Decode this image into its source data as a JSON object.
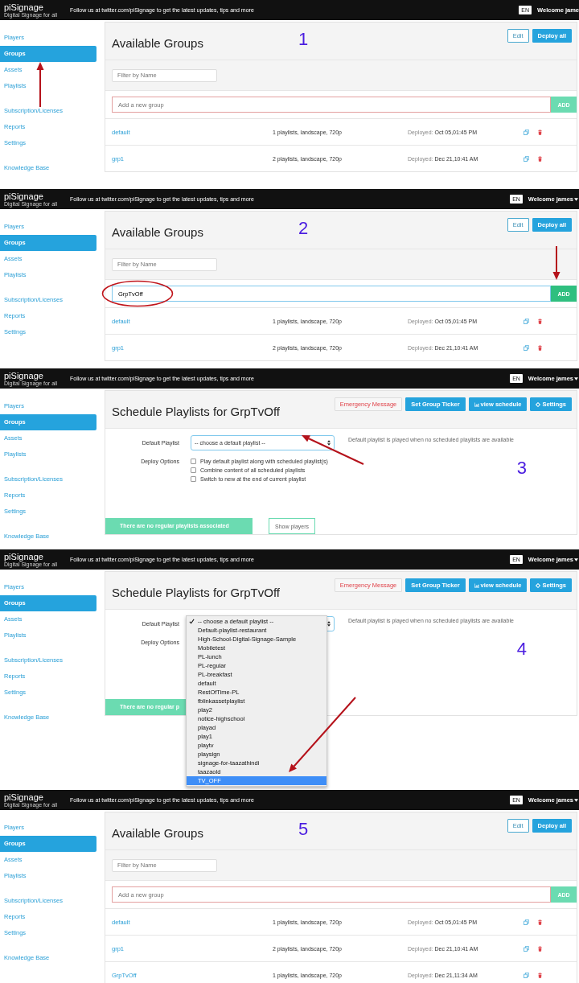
{
  "panels": [
    {
      "kind": "groups",
      "step": "1",
      "header": {
        "brand": "piSignage",
        "brand_sub": "Digital Signage for all",
        "tagline": "Follow us at twitter.com/piSignage to get the latest updates, tips and more",
        "lang": "EN",
        "welcome": "Welcome jame",
        "menu_caret": false
      },
      "sidebar": [
        [
          {
            "label": "Players",
            "selected": false
          },
          {
            "label": "Groups",
            "selected": true
          },
          {
            "label": "Assets",
            "selected": false
          },
          {
            "label": "Playlists",
            "selected": false
          }
        ],
        [
          {
            "label": "Subscription/Licenses",
            "selected": false
          },
          {
            "label": "Reports",
            "selected": false
          },
          {
            "label": "Settings",
            "selected": false
          }
        ],
        [
          {
            "label": "Knowledge Base",
            "selected": false
          }
        ]
      ],
      "title": "Available Groups",
      "actions": [
        {
          "label": "Edit",
          "kind": "outline"
        },
        {
          "label": "Deploy all",
          "kind": "primary"
        }
      ],
      "filter": {
        "placeholder": "Filter by Name"
      },
      "add_field": {
        "placeholder": "Add a new group",
        "circled": false
      },
      "add_button": "ADD",
      "groups": [
        {
          "name": "default",
          "info": "1 playlists, landscape, 720p",
          "deployed_label": "Deployed:",
          "deployed": "Oct 05,01:45 PM"
        },
        {
          "name": "grp1",
          "info": "2 playlists, landscape, 720p",
          "deployed_label": "Deployed:",
          "deployed": "Dec 21,10:41 AM"
        }
      ]
    },
    {
      "kind": "groups",
      "step": "2",
      "header": {
        "brand": "piSignage",
        "brand_sub": "Digital Signage for all",
        "tagline": "Follow us at twitter.com/piSignage to get the latest updates, tips and more",
        "lang": "EN",
        "welcome": "Welcome james",
        "menu_caret": true
      },
      "sidebar": [
        [
          {
            "label": "Players",
            "selected": false
          },
          {
            "label": "Groups",
            "selected": true
          },
          {
            "label": "Assets",
            "selected": false
          },
          {
            "label": "Playlists",
            "selected": false
          }
        ],
        [
          {
            "label": "Subscription/Licenses",
            "selected": false
          },
          {
            "label": "Reports",
            "selected": false
          },
          {
            "label": "Settings",
            "selected": false
          }
        ]
      ],
      "title": "Available Groups",
      "actions": [
        {
          "label": "Edit",
          "kind": "outline"
        },
        {
          "label": "Deploy all",
          "kind": "primary"
        }
      ],
      "filter": {
        "placeholder": "Filter by Name"
      },
      "add_field": {
        "value": "GrpTvOff",
        "circled": true
      },
      "add_button": "ADD",
      "groups": [
        {
          "name": "default",
          "info": "1 playlists, landscape, 720p",
          "deployed_label": "Deployed:",
          "deployed": "Oct 05,01:45 PM"
        },
        {
          "name": "grp1",
          "info": "2 playlists, landscape, 720p",
          "deployed_label": "Deployed:",
          "deployed": "Dec 21,10:41 AM"
        }
      ]
    },
    {
      "kind": "schedule",
      "step": "3",
      "header": {
        "brand": "piSignage",
        "brand_sub": "Digital Signage for all",
        "tagline": "Follow us at twitter.com/piSignage to get the latest updates, tips and more",
        "lang": "EN",
        "welcome": "Welcome james",
        "menu_caret": true
      },
      "sidebar": [
        [
          {
            "label": "Players",
            "selected": false
          },
          {
            "label": "Groups",
            "selected": true
          },
          {
            "label": "Assets",
            "selected": false
          },
          {
            "label": "Playlists",
            "selected": false
          }
        ],
        [
          {
            "label": "Subscription/Licenses",
            "selected": false
          },
          {
            "label": "Reports",
            "selected": false
          },
          {
            "label": "Settings",
            "selected": false
          }
        ],
        [
          {
            "label": "Knowledge Base",
            "selected": false
          }
        ]
      ],
      "title": "Schedule Playlists for GrpTvOff",
      "actions": [
        {
          "label": "Emergency Message",
          "kind": "danger"
        },
        {
          "label": "Set Group Ticker",
          "kind": "primary"
        },
        {
          "label": "view schedule",
          "kind": "schedule"
        },
        {
          "label": "Settings",
          "kind": "settings"
        }
      ],
      "default_playlist": {
        "label": "Default Playlist",
        "value": "-- choose a default playlist --",
        "hint": "Default playlist is played when no scheduled playlists are available"
      },
      "deploy_options": {
        "label": "Deploy Options",
        "options": [
          {
            "label": "Play default playlist along with scheduled playlist(s)",
            "checked": false
          },
          {
            "label": "Combine content of all scheduled playlists",
            "checked": false
          },
          {
            "label": "Switch to new at the end of current playlist",
            "checked": false
          }
        ]
      },
      "status": "There are no regular playlists associated",
      "show_players": "Show players"
    },
    {
      "kind": "schedule",
      "step": "4",
      "header": {
        "brand": "piSignage",
        "brand_sub": "Digital Signage for all",
        "tagline": "Follow us at twitter.com/piSignage to get the latest updates, tips and more",
        "lang": "EN",
        "welcome": "Welcome james",
        "menu_caret": true
      },
      "sidebar": [
        [
          {
            "label": "Players",
            "selected": false
          },
          {
            "label": "Groups",
            "selected": true
          },
          {
            "label": "Assets",
            "selected": false
          },
          {
            "label": "Playlists",
            "selected": false
          }
        ],
        [
          {
            "label": "Subscription/Licenses",
            "selected": false
          },
          {
            "label": "Reports",
            "selected": false
          },
          {
            "label": "Settings",
            "selected": false
          }
        ],
        [
          {
            "label": "Knowledge Base",
            "selected": false
          }
        ]
      ],
      "title": "Schedule Playlists for GrpTvOff",
      "actions": [
        {
          "label": "Emergency Message",
          "kind": "danger"
        },
        {
          "label": "Set Group Ticker",
          "kind": "primary"
        },
        {
          "label": "view schedule",
          "kind": "schedule"
        },
        {
          "label": "Settings",
          "kind": "settings"
        }
      ],
      "default_playlist": {
        "label": "Default Playlist",
        "hint": "Default playlist is played when no scheduled playlists are available"
      },
      "dropdown": [
        {
          "label": "-- choose a default playlist --",
          "checked": true,
          "selected": false
        },
        {
          "label": "Default-playlist-restaurant",
          "checked": false,
          "selected": false
        },
        {
          "label": "High-School-Digital-Signage-Sample",
          "checked": false,
          "selected": false
        },
        {
          "label": "Mobiletest",
          "checked": false,
          "selected": false
        },
        {
          "label": "PL-lunch",
          "checked": false,
          "selected": false
        },
        {
          "label": "PL-regular",
          "checked": false,
          "selected": false
        },
        {
          "label": "PL-breakfast",
          "checked": false,
          "selected": false
        },
        {
          "label": "default",
          "checked": false,
          "selected": false
        },
        {
          "label": "RestOfTime-PL",
          "checked": false,
          "selected": false
        },
        {
          "label": "fblinkassetplaylist",
          "checked": false,
          "selected": false
        },
        {
          "label": "play2",
          "checked": false,
          "selected": false
        },
        {
          "label": "notice-highschool",
          "checked": false,
          "selected": false
        },
        {
          "label": "playad",
          "checked": false,
          "selected": false
        },
        {
          "label": "play1",
          "checked": false,
          "selected": false
        },
        {
          "label": "playtv",
          "checked": false,
          "selected": false
        },
        {
          "label": "playsign",
          "checked": false,
          "selected": false
        },
        {
          "label": "signage-for-taazathindi",
          "checked": false,
          "selected": false
        },
        {
          "label": "taazaold",
          "checked": false,
          "selected": false
        },
        {
          "label": "TV_OFF",
          "checked": false,
          "selected": true
        }
      ],
      "deploy_options": {
        "label": "Deploy Options"
      },
      "status": "There are no regular p"
    },
    {
      "kind": "groups",
      "step": "5",
      "header": {
        "brand": "piSignage",
        "brand_sub": "Digital Signage for all",
        "tagline": "Follow us at twitter.com/piSignage to get the latest updates, tips and more",
        "lang": "EN",
        "welcome": "Welcome james",
        "menu_caret": true
      },
      "sidebar": [
        [
          {
            "label": "Players",
            "selected": false
          },
          {
            "label": "Groups",
            "selected": true
          },
          {
            "label": "Assets",
            "selected": false
          },
          {
            "label": "Playlists",
            "selected": false
          }
        ],
        [
          {
            "label": "Subscription/Licenses",
            "selected": false
          },
          {
            "label": "Reports",
            "selected": false
          },
          {
            "label": "Settings",
            "selected": false
          }
        ],
        [
          {
            "label": "Knowledge Base",
            "selected": false
          }
        ]
      ],
      "title": "Available Groups",
      "actions": [
        {
          "label": "Edit",
          "kind": "outline"
        },
        {
          "label": "Deploy all",
          "kind": "primary"
        }
      ],
      "filter": {
        "placeholder": "Filter by Name"
      },
      "add_field": {
        "placeholder": "Add a new group",
        "circled": false
      },
      "add_button": "ADD",
      "groups": [
        {
          "name": "default",
          "info": "1 playlists, landscape, 720p",
          "deployed_label": "Deployed:",
          "deployed": "Oct 05,01:45 PM"
        },
        {
          "name": "grp1",
          "info": "2 playlists, landscape, 720p",
          "deployed_label": "Deployed:",
          "deployed": "Dec 21,10:41 AM"
        },
        {
          "name": "GrpTvOff",
          "info": "1 playlists, landscape, 720p",
          "deployed_label": "Deployed:",
          "deployed": "Dec 21,11:34 AM"
        }
      ]
    }
  ]
}
